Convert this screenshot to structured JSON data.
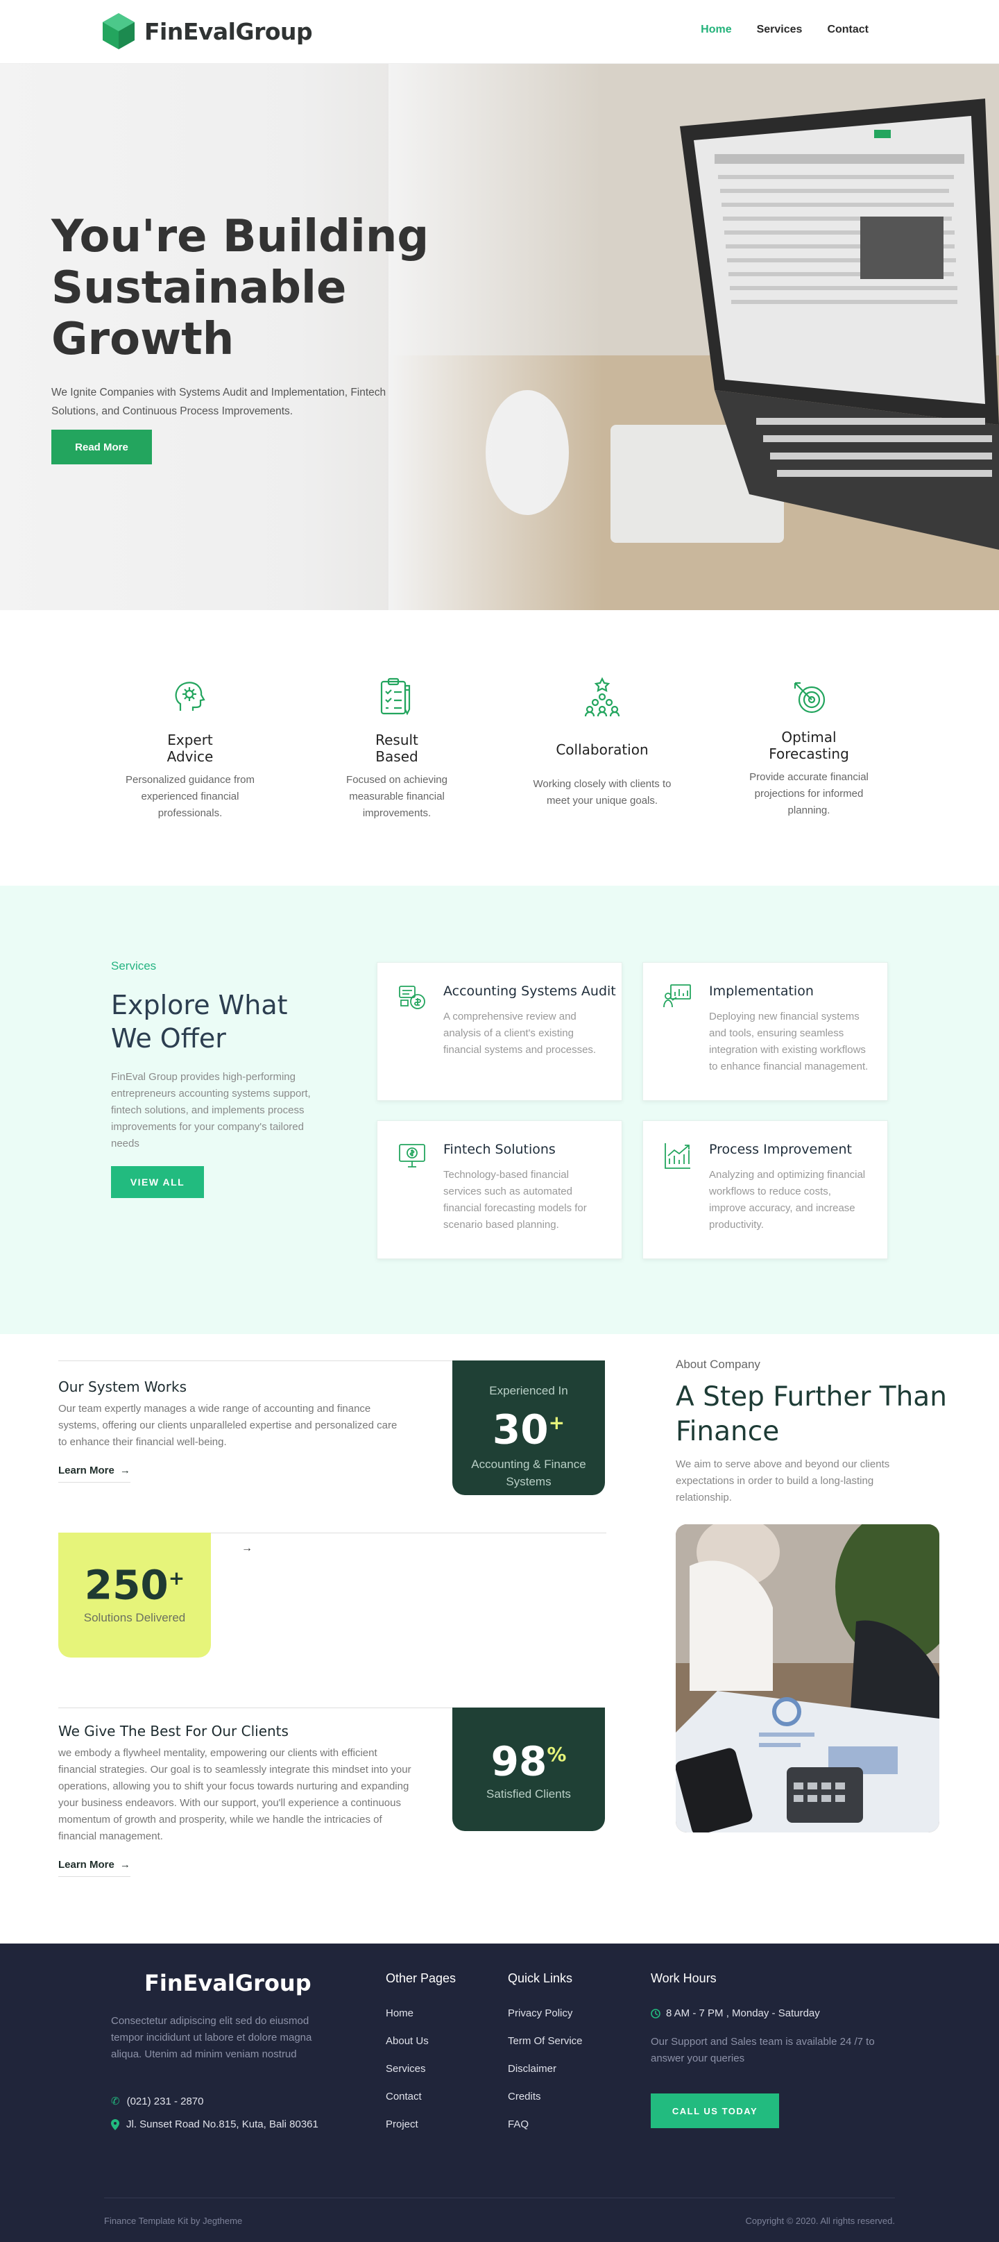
{
  "header": {
    "brand": "FinEvalGroup",
    "nav": [
      "Home",
      "Services",
      "Contact"
    ],
    "active_nav": "Home"
  },
  "hero": {
    "title": "You're Building Sustainable Growth",
    "subtitle": "We Ignite Companies with Systems Audit and Implementation, Fintech Solutions, and Continuous Process Improvements.",
    "button": "Read More"
  },
  "features": [
    {
      "icon": "brain-gear-icon",
      "title": "Expert Advice",
      "text": "Personalized guidance from experienced financial professionals."
    },
    {
      "icon": "checklist-icon",
      "title": "Result Based",
      "text": "Focused on achieving measurable financial improvements."
    },
    {
      "icon": "teamwork-icon",
      "title": "Collaboration",
      "text": "Working closely with clients to meet your unique goals."
    },
    {
      "icon": "target-icon",
      "title": "Optimal Forecasting",
      "text": "Provide accurate financial projections for informed planning."
    }
  ],
  "services": {
    "kicker": "Services",
    "title": "Explore What We Offer",
    "description": "FinEval Group provides high-performing entrepreneurs accounting systems support, fintech solutions, and implements process improvements for your company's tailored needs",
    "button": "VIEW ALL",
    "cards": [
      {
        "icon": "coins-audit-icon",
        "title": "Accounting Systems Audit",
        "text": "A comprehensive review and analysis of a client's existing financial systems and processes."
      },
      {
        "icon": "presentation-chart-icon",
        "title": "Implementation",
        "text": "Deploying new financial systems and tools, ensuring seamless integration with existing workflows to enhance financial management."
      },
      {
        "icon": "monitor-dollar-icon",
        "title": "Fintech Solutions",
        "text": "Technology-based financial services such as automated financial forecasting models for scenario based planning."
      },
      {
        "icon": "growth-chart-icon",
        "title": "Process Improvement",
        "text": "Analyzing and optimizing financial workflows to reduce costs, improve accuracy, and increase productivity."
      }
    ]
  },
  "about": {
    "kicker": "About Company",
    "title": "A Step Further Than Finance",
    "text": "We aim to serve above and beyond our clients expectations in order to build a long-lasting relationship.",
    "system": {
      "title": "Our System Works",
      "text": "Our team expertly manages a wide range of accounting and finance systems, offering our clients unparalleled expertise and personalized care to enhance their financial well-being.",
      "link": "Learn More"
    },
    "experience": {
      "top": "Experienced In",
      "number": "30",
      "plus": "+",
      "bottom": "Accounting & Finance Systems"
    },
    "solutions": {
      "number": "250",
      "plus": "+",
      "label": "Solutions Delivered"
    },
    "best": {
      "title": "We Give The Best For Our Clients",
      "text": "we embody a flywheel mentality, empowering our clients with efficient financial strategies. Our goal is to seamlessly integrate this mindset into your operations, allowing you to shift your focus towards nurturing and expanding your business endeavors. With our support, you'll experience a continuous momentum of growth and prosperity, while we handle the intricacies of financial management.",
      "link": "Learn More"
    },
    "satisfied": {
      "number": "98",
      "suffix": "%",
      "label": "Satisfied Clients"
    }
  },
  "footer": {
    "brand": "FinEvalGroup",
    "description": "Consectetur adipiscing elit sed do eiusmod tempor incididunt ut labore et dolore magna aliqua. Utenim ad minim veniam nostrud",
    "phone": "(021) 231 - 2870",
    "address": "Jl. Sunset Road No.815, Kuta, Bali 80361",
    "other_pages_title": "Other Pages",
    "other_pages": [
      "Home",
      "About Us",
      "Services",
      "Contact",
      "Project"
    ],
    "quick_links_title": "Quick Links",
    "quick_links": [
      "Privacy Policy",
      "Term Of Service",
      "Disclaimer",
      "Credits",
      "FAQ"
    ],
    "hours_title": "Work Hours",
    "hours": "8 AM - 7 PM , Monday - Saturday",
    "support": "Our Support and Sales team is available 24 /7 to answer your queries",
    "button": "CALL US TODAY",
    "credit": "Finance Template Kit by Jegtheme",
    "copyright": "Copyright © 2020. All rights reserved."
  },
  "colors": {
    "brand_green": "#23a55e",
    "accent_green": "#22bb7f",
    "dark_green": "#1f4035",
    "lime": "#e6f47a",
    "mint_bg": "#ebfcf6",
    "footer_bg": "#20253a"
  }
}
